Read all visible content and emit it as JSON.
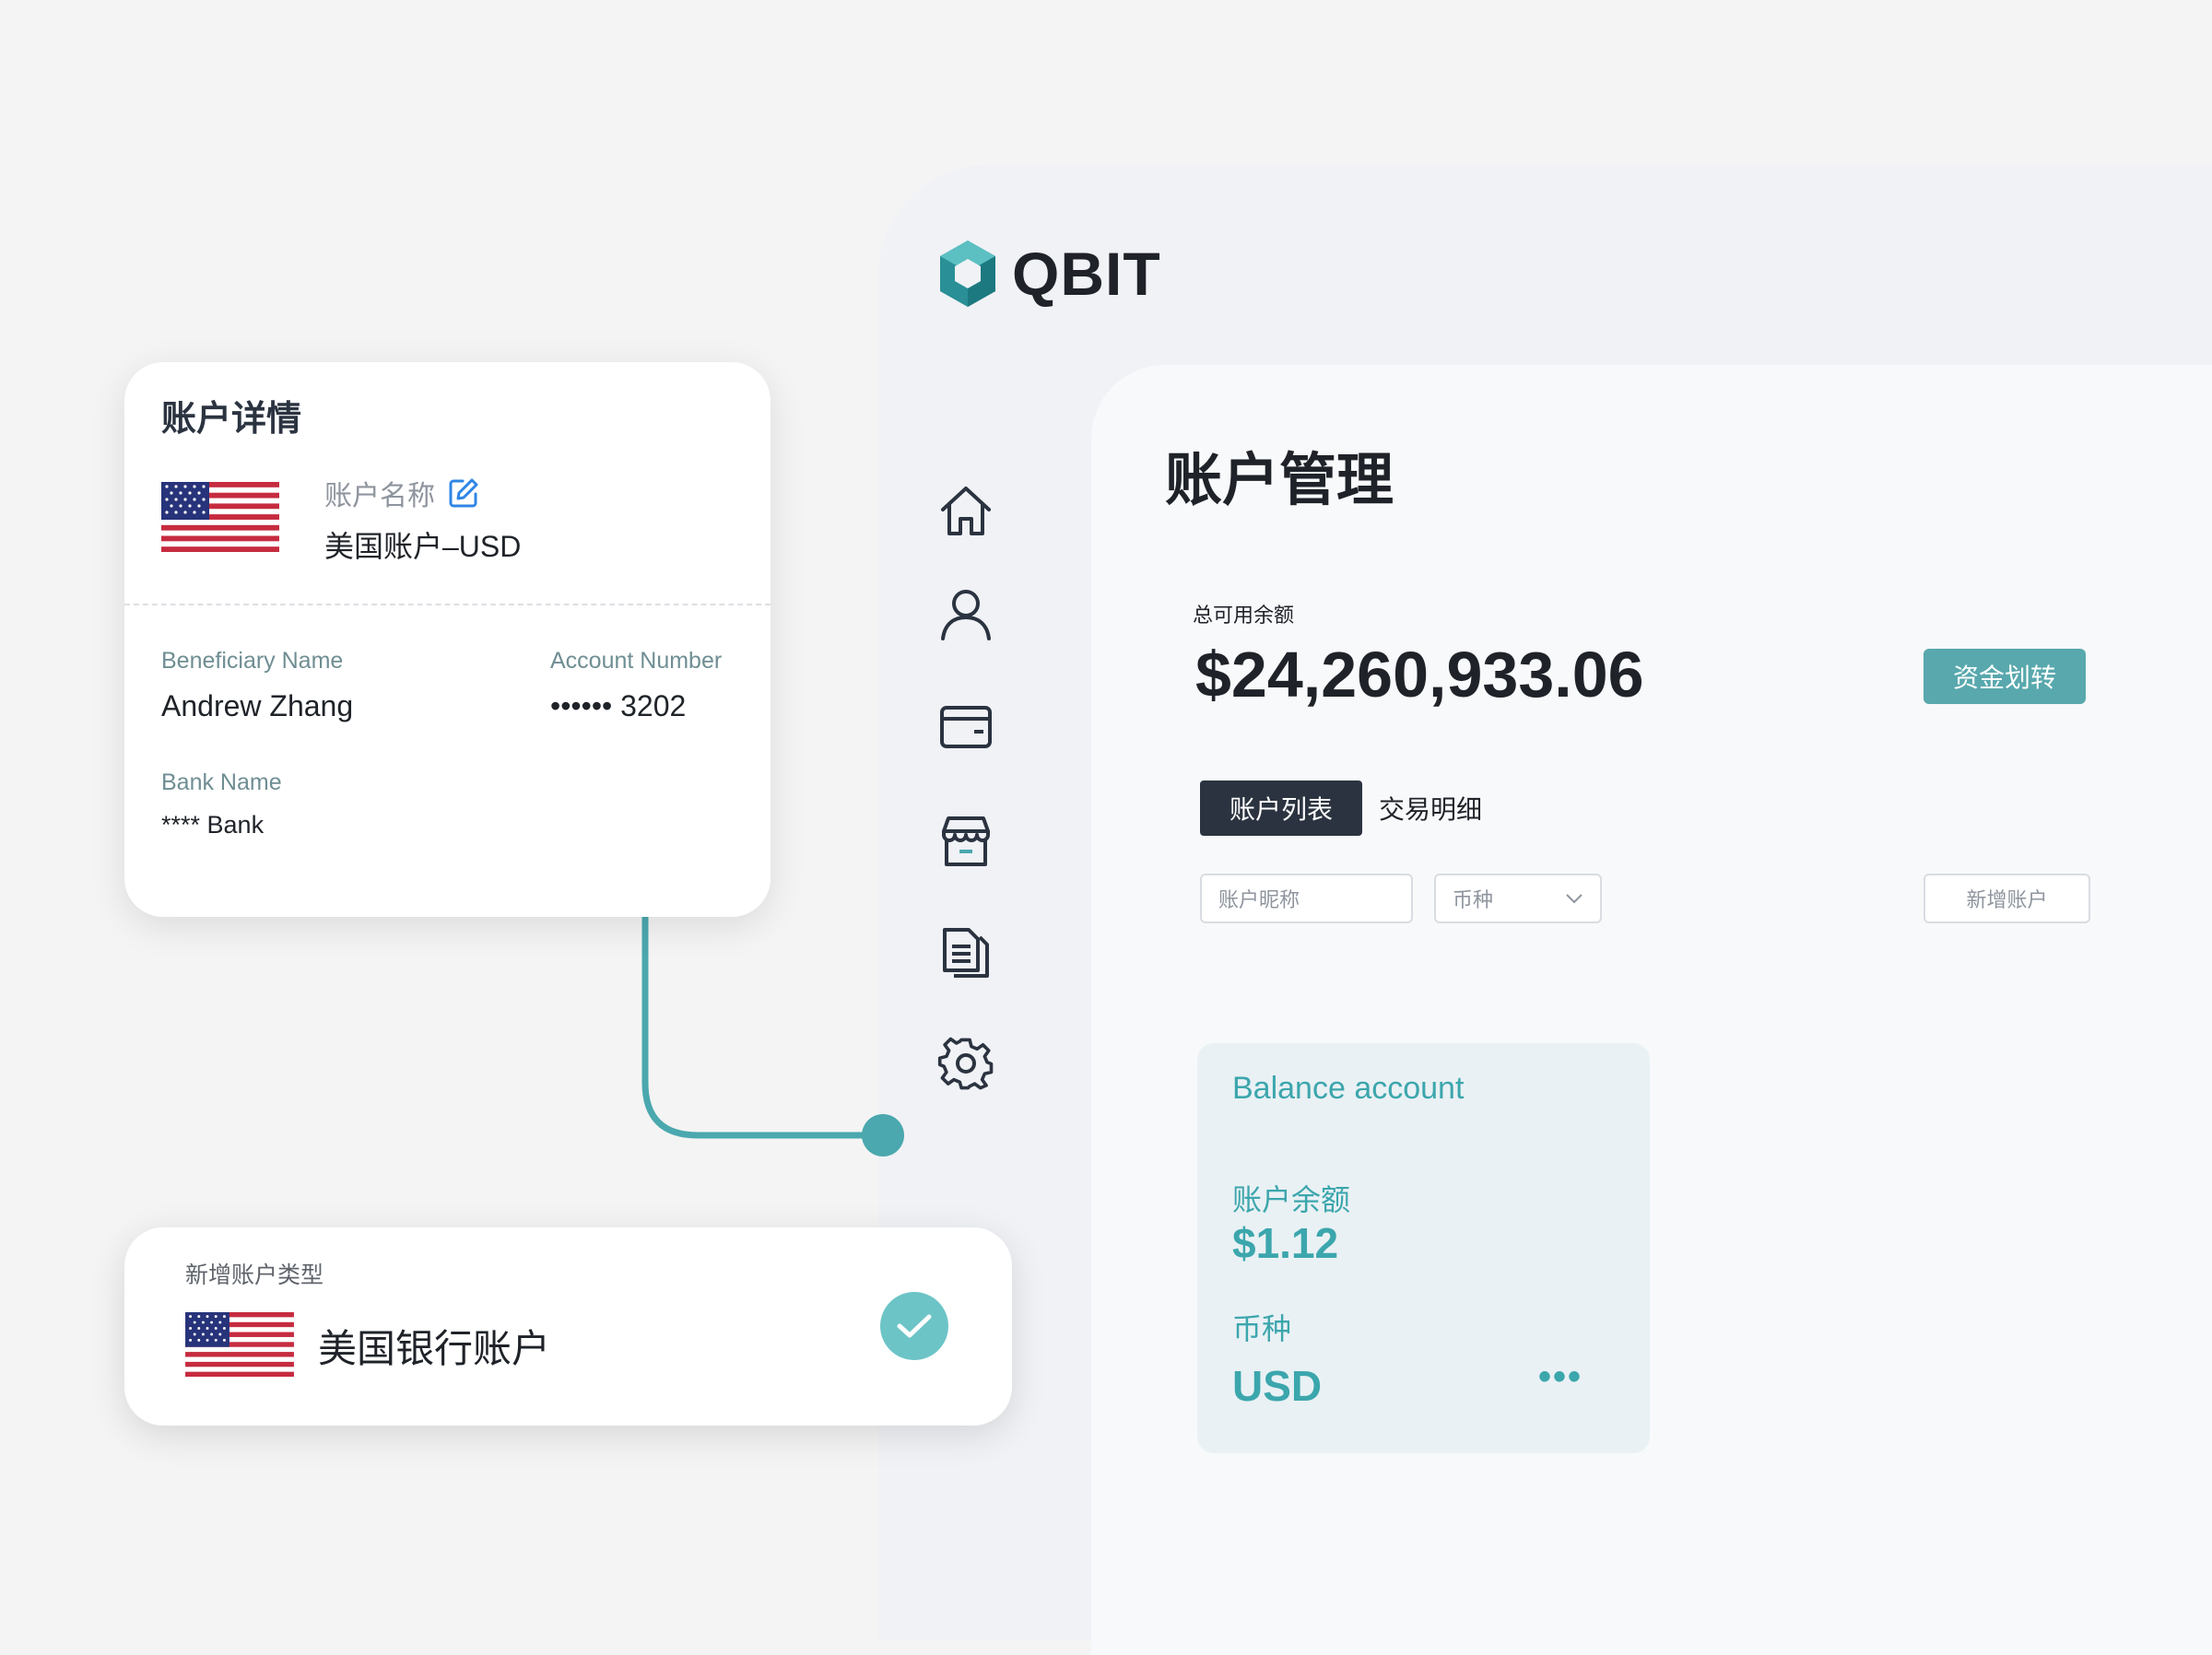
{
  "brand": {
    "name": "QBIT",
    "accent": "#58a8ad"
  },
  "sidebar": {
    "items": [
      {
        "icon": "home-icon"
      },
      {
        "icon": "user-icon"
      },
      {
        "icon": "card-icon"
      },
      {
        "icon": "store-icon"
      },
      {
        "icon": "document-icon"
      },
      {
        "icon": "gear-icon"
      }
    ]
  },
  "main": {
    "title": "账户管理",
    "total_label": "总可用余额",
    "total_value": "$24,260,933.06",
    "transfer_button": "资金划转",
    "tabs": [
      {
        "label": "账户列表",
        "active": true
      },
      {
        "label": "交易明细",
        "active": false
      }
    ],
    "filters": {
      "nickname_placeholder": "账户昵称",
      "currency_placeholder": "币种",
      "add_account": "新增账户"
    },
    "balance_card": {
      "title": "Balance account",
      "balance_label": "账户余额",
      "balance_value": "$1.12",
      "currency_label": "币种",
      "currency_value": "USD",
      "more": "•••"
    }
  },
  "detail_card": {
    "title": "账户详情",
    "account_name_label": "账户名称",
    "account_name_value": "美国账户–USD",
    "beneficiary_label": "Beneficiary Name",
    "beneficiary_value": "Andrew Zhang",
    "account_number_label": "Account Number",
    "account_number_value": "•••••• 3202",
    "bank_name_label": "Bank Name",
    "bank_name_value": "**** Bank",
    "flag_icon": "us-flag-icon"
  },
  "type_card": {
    "label": "新增账户类型",
    "value": "美国银行账户",
    "flag_icon": "us-flag-icon",
    "check_icon": "check-icon"
  }
}
